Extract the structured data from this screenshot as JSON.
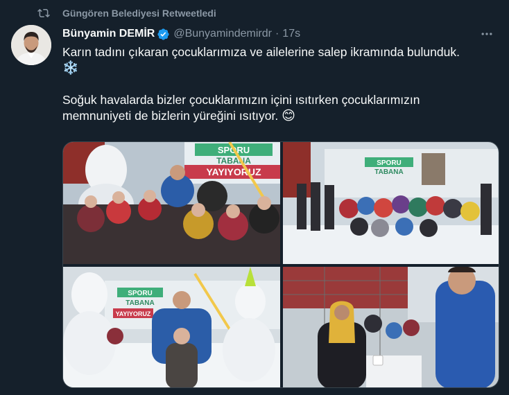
{
  "retweet": {
    "icon": "retweet-icon",
    "text": "Güngören Belediyesi Retweetledi"
  },
  "author": {
    "name": "Bünyamin DEMİR",
    "handle": "@Bunyamindemirdr",
    "separator": "·",
    "time": "17s",
    "verified": true,
    "avatar_icon": "avatar"
  },
  "tweet": {
    "line1": "Karın tadını çıkaran çocuklarımıza ve ailelerine salep ikramında bulunduk.",
    "emoji1": "❄️",
    "line2": "Soğuk havalarda bizler çocuklarımızın içini ısıtırken çocuklarımızın",
    "line3": "memnuniyeti de bizlerin yüreğini ısıtıyor.",
    "emoji2": "😊"
  },
  "media": {
    "banner_line1": "SPORU",
    "banner_line2": "TABANA",
    "banner_line3": "YAYIYORUZ"
  },
  "colors": {
    "background": "#15202b",
    "text": "#f7f9f9",
    "secondary": "#8b98a5",
    "verified": "#1d9bf0"
  }
}
